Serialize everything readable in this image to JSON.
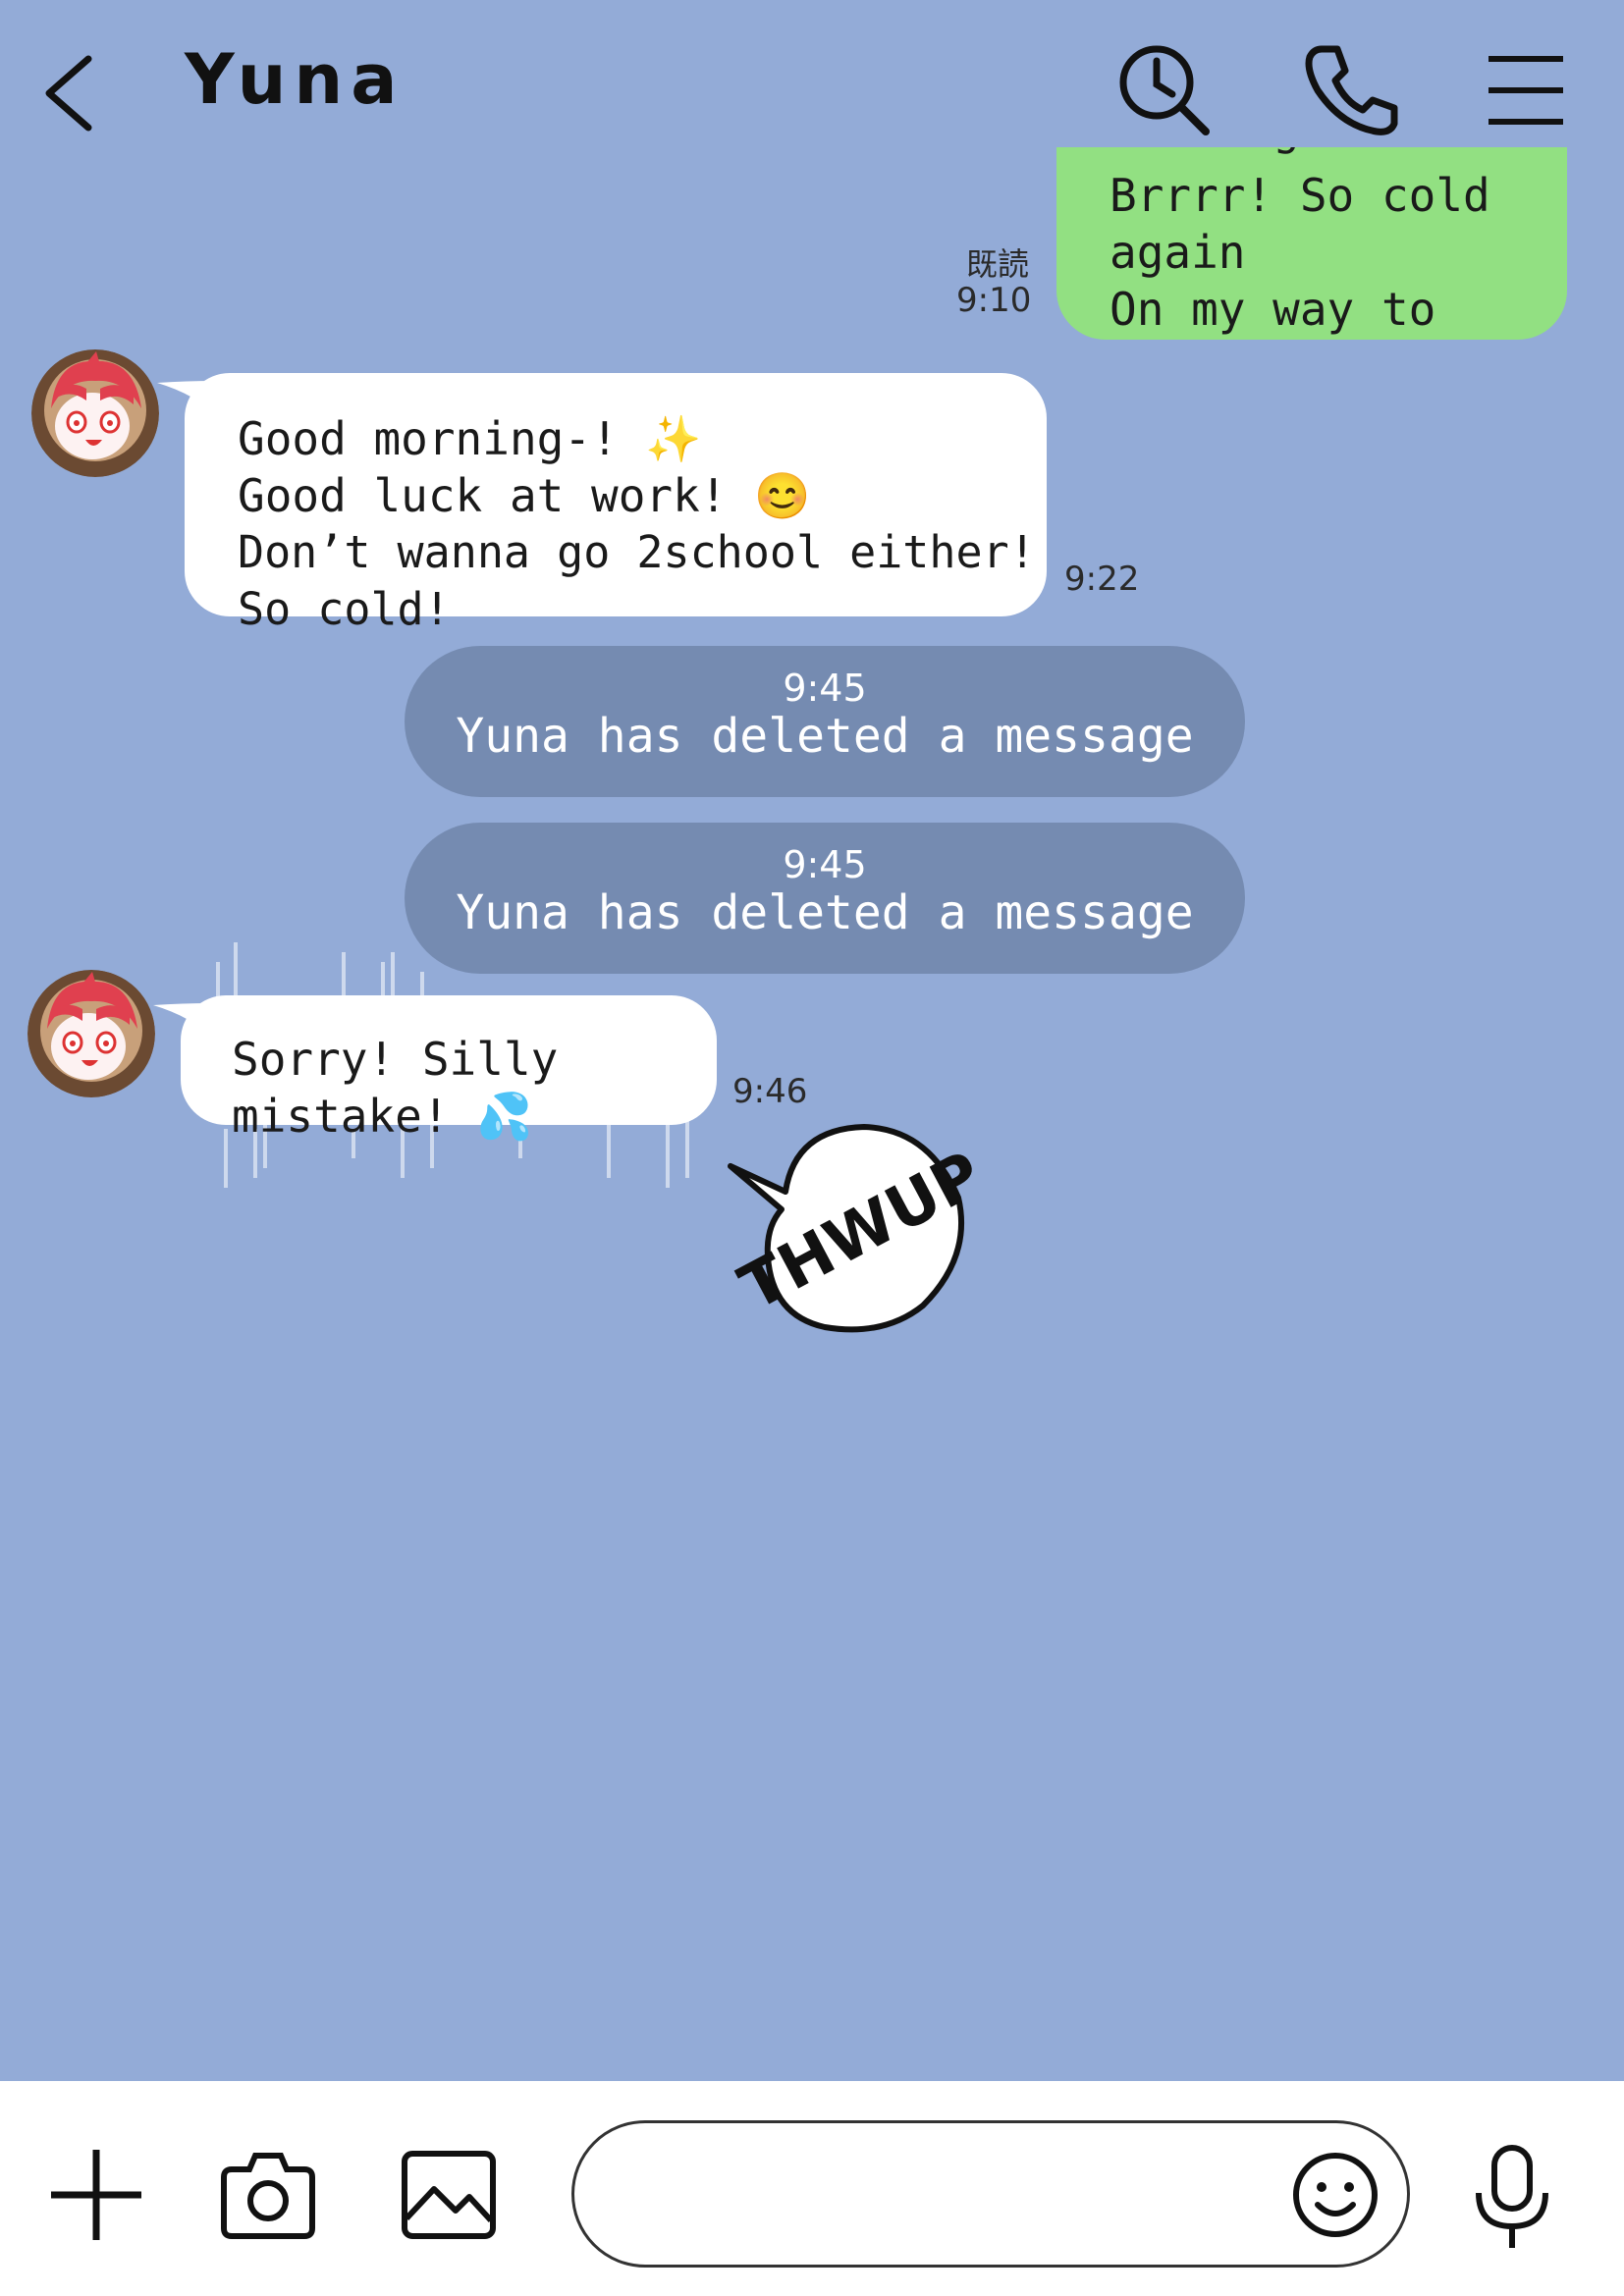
{
  "header": {
    "contact_name": "Yuna"
  },
  "messages": {
    "outgoing": {
      "lines": [
        "Morning",
        "Brrrr! So cold again",
        "On my way to work..."
      ],
      "read_label": "既読",
      "time": "9:10"
    },
    "incoming_1": {
      "lines": [
        "Good morning-! ✨",
        "Good luck at work! 😊",
        "Don’t wanna go 2school either! So cold!"
      ],
      "time": "9:22"
    },
    "deleted_1": {
      "time": "9:45",
      "text": "Yuna has deleted a message"
    },
    "deleted_2": {
      "time": "9:45",
      "text": "Yuna has deleted a message"
    },
    "incoming_2": {
      "text": "Sorry! Silly mistake! 💦",
      "time": "9:46"
    },
    "sound_effect": "THWUP"
  },
  "input": {
    "placeholder": ""
  },
  "colors": {
    "background": "#93abd7",
    "outgoing_bubble": "#92e082",
    "incoming_bubble": "#ffffff",
    "deleted_pill": "#758bb1"
  }
}
